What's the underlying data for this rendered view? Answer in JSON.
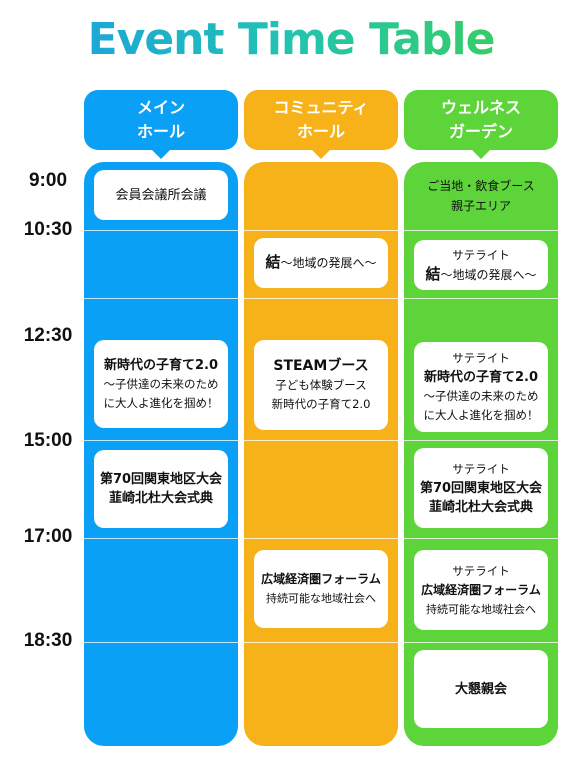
{
  "title": "Event Time Table",
  "times": [
    "9:00",
    "10:30",
    "12:30",
    "15:00",
    "17:00",
    "18:30"
  ],
  "columns": {
    "main": {
      "line1": "メイン",
      "line2": "ホール",
      "color": "#0aa0f5"
    },
    "community": {
      "line1": "コミュニティ",
      "line2": "ホール",
      "color": "#f7b21a"
    },
    "wellness": {
      "line1": "ウェルネス",
      "line2": "ガーデン",
      "color": "#5cd43a"
    }
  },
  "main_events": {
    "kaigi": "会員会議所会議",
    "kosodate_title": "新時代の子育て2.0",
    "kosodate_sub1": "～子供達の未来のため",
    "kosodate_sub2": "に大人よ進化を掴め！",
    "taikai_1": "第70回関東地区大会",
    "taikai_2": "韮崎北杜大会式典"
  },
  "community_events": {
    "musubi_bold": "結",
    "musubi_rest": "～地域の発展へ～",
    "steam_title": "STEAMブース",
    "steam_sub1": "子ども体験ブース",
    "steam_sub2": "新時代の子育て2.0",
    "forum_title": "広域経済圏フォーラム",
    "forum_sub": "持続可能な地域社会へ"
  },
  "wellness_events": {
    "food_1": "ご当地・飲食ブース",
    "food_2": "親子エリア",
    "sat_label": "サテライト",
    "musubi_bold": "結",
    "musubi_rest": "～地域の発展へ～",
    "kosodate_title": "新時代の子育て2.0",
    "kosodate_sub1": "～子供達の未来のため",
    "kosodate_sub2": "に大人よ進化を掴め！",
    "taikai_1": "第70回関東地区大会",
    "taikai_2": "韮崎北杜大会式典",
    "forum_title": "広域経済圏フォーラム",
    "forum_sub": "持続可能な地域社会へ",
    "konshinkai": "大懇親会"
  }
}
